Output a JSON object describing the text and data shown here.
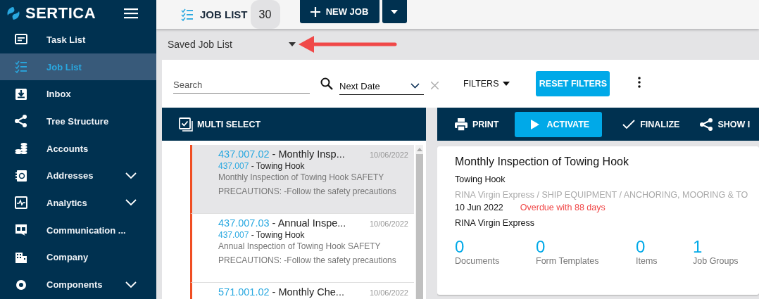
{
  "brand": {
    "name": "SERTICA"
  },
  "sidebar": {
    "items": [
      {
        "label": "Task List",
        "selected": false,
        "expandable": false
      },
      {
        "label": "Job List",
        "selected": true,
        "expandable": false
      },
      {
        "label": "Inbox",
        "selected": false,
        "expandable": false
      },
      {
        "label": "Tree Structure",
        "selected": false,
        "expandable": false
      },
      {
        "label": "Accounts",
        "selected": false,
        "expandable": false
      },
      {
        "label": "Addresses",
        "selected": false,
        "expandable": true
      },
      {
        "label": "Analytics",
        "selected": false,
        "expandable": true
      },
      {
        "label": "Communication ...",
        "selected": false,
        "expandable": false
      },
      {
        "label": "Company",
        "selected": false,
        "expandable": false
      },
      {
        "label": "Components",
        "selected": false,
        "expandable": true
      }
    ]
  },
  "header": {
    "title": "JOB LIST",
    "count": "30",
    "new_button": "NEW JOB"
  },
  "saved_list": {
    "label": "Saved Job List"
  },
  "filters": {
    "search": {
      "placeholder": "Search"
    },
    "sort": {
      "value": "Next Date"
    },
    "filters_label": "FILTERS",
    "reset_button": "RESET FILTERS"
  },
  "list_toolbar": {
    "multi_select": "MULTI SELECT"
  },
  "jobs": [
    {
      "code": "437.007.02",
      "title": "- Monthly Insp...",
      "date": "10/06/2022",
      "component_code": "437.007",
      "component": "- Towing Hook",
      "description": "Monthly Inspection of Towing Hook SAFETY PRECAUTIONS: -Follow the safety precautions",
      "selected": true
    },
    {
      "code": "437.007.03",
      "title": "- Annual Inspe...",
      "date": "10/06/2022",
      "component_code": "437.007",
      "component": "- Towing Hook",
      "description": "Annual Inspection of Towing Hook SAFETY PRECAUTIONS: -Follow the safety precautions",
      "selected": false
    },
    {
      "code": "571.001.02",
      "title": "- Monthly Che...",
      "date": "10/06/2022",
      "selected": false
    }
  ],
  "detail_toolbar": [
    {
      "label": "PRINT",
      "primary": false
    },
    {
      "label": "ACTIVATE",
      "primary": true
    },
    {
      "label": "FINALIZE",
      "primary": false
    },
    {
      "label": "SHOW I",
      "primary": false
    }
  ],
  "detail": {
    "title": "Monthly Inspection of Towing Hook",
    "component": "Towing Hook",
    "path": "RINA Virgin Express / SHIP EQUIPMENT / ANCHORING, MOORING & TO",
    "date": "10 Jun 2022",
    "status": "Overdue with 88 days",
    "vessel": "RINA Virgin Express",
    "stats": [
      {
        "value": "0",
        "label": "Documents"
      },
      {
        "value": "0",
        "label": "Form Templates"
      },
      {
        "value": "0",
        "label": "Items"
      },
      {
        "value": "1",
        "label": "Job Groups"
      }
    ]
  }
}
